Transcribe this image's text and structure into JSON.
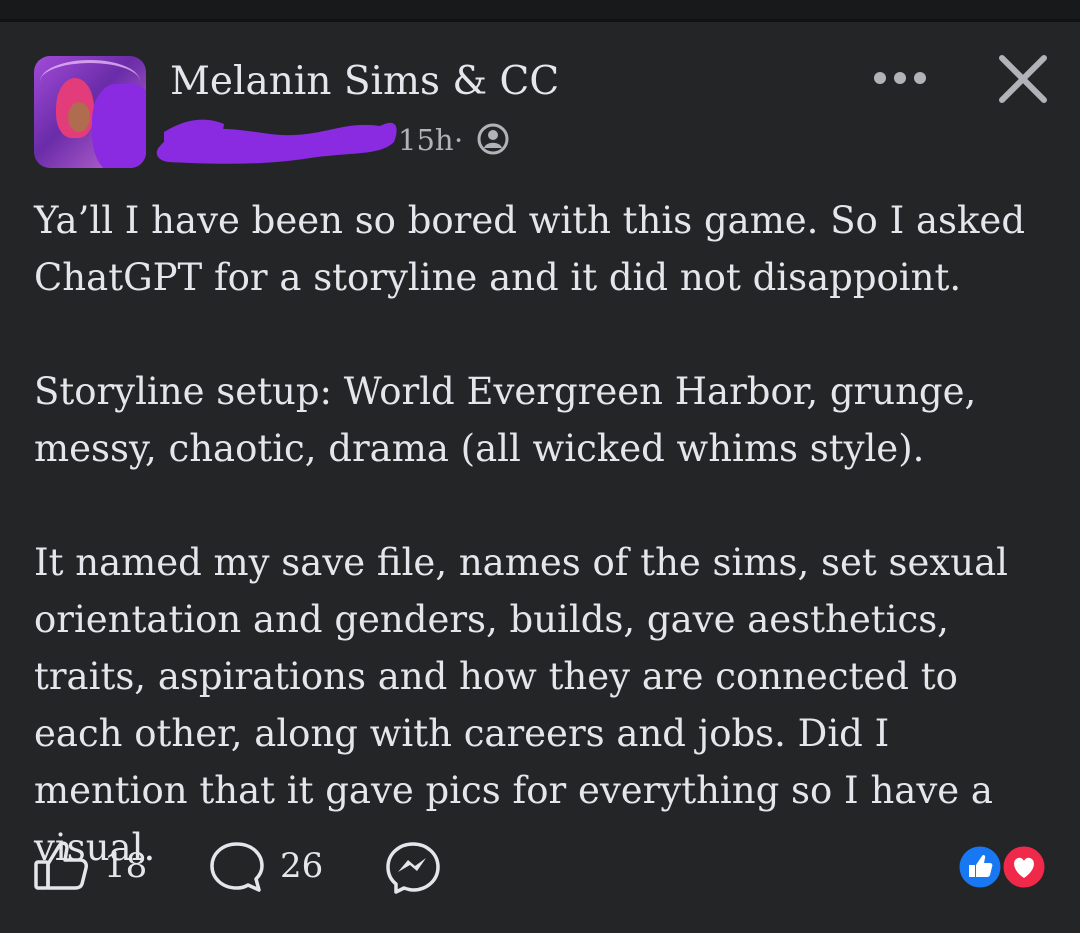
{
  "post": {
    "page_name": "Melanin Sims & CC",
    "timestamp": "15h",
    "separator": "·",
    "audience_icon": "public-globe-icon",
    "paragraphs": [
      "Ya’ll I have been so bored with this game. So I asked ChatGPT for a storyline and it did not disappoint.",
      "Storyline setup: World Evergreen Harbor, grunge, messy, chaotic, drama (all wicked whims style).",
      "It named my save file, names of the sims, set sexual orientation and genders, builds, gave aesthetics, traits, aspirations and how they are connected to each other, along with careers and jobs. Did I mention that it gave pics for everything so I have a visual."
    ]
  },
  "footer": {
    "like_count": "18",
    "comment_count": "26",
    "like_icon": "thumbs-up-icon",
    "comment_icon": "comment-bubble-icon",
    "share_icon": "messenger-icon",
    "reaction_icons": [
      "like-reaction-icon",
      "love-reaction-icon"
    ]
  },
  "colors": {
    "background": "#242526",
    "text": "#e4e6eb",
    "secondary_text": "#b0b3b8",
    "redaction": "#8a2be2",
    "like_blue": "#1877f2",
    "love_red": "#f0284a"
  }
}
